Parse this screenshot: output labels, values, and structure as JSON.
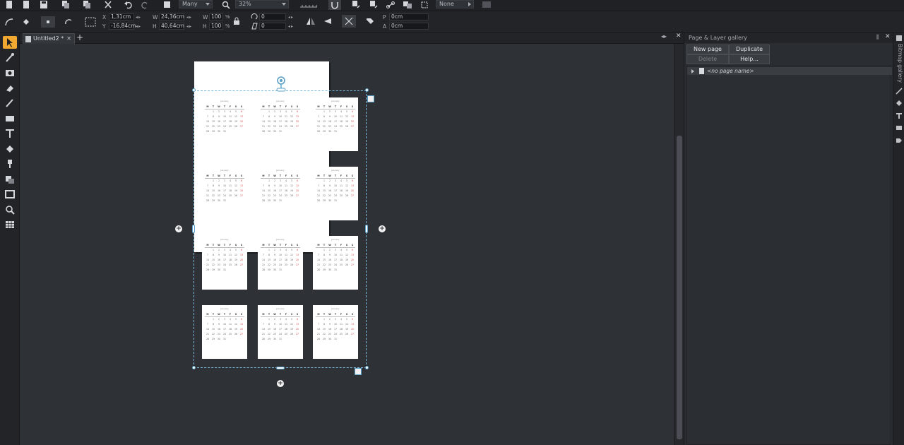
{
  "toolbar": {
    "items_combo": "Many",
    "zoom_combo": "32%",
    "feather_combo": "None",
    "x_label": "X",
    "x_value": "1,31cm",
    "y_label": "Y",
    "y_value": "-16,84cm",
    "w_label": "W",
    "w_value": "24,36cm",
    "h_label": "H",
    "h_value": "40,64cm",
    "sw_label": "W",
    "sw_value": "100",
    "sh_label": "H",
    "sh_value": "100",
    "pct": "%",
    "angle_value": "0",
    "skew_value": "0",
    "p_label": "P",
    "p_value": "0cm",
    "a_label": "A",
    "a_value": "0cm"
  },
  "tabs": {
    "document": "Untitled2 *",
    "close": "✕",
    "new": "+"
  },
  "calendar": {
    "month_title": "January",
    "days": [
      "M",
      "T",
      "W",
      "T",
      "F",
      "S",
      "S"
    ],
    "dates": [
      [
        "",
        "1",
        "2",
        "3",
        "4",
        "5",
        "6"
      ],
      [
        "7",
        "8",
        "9",
        "10",
        "11",
        "12",
        "13"
      ],
      [
        "14",
        "15",
        "16",
        "17",
        "18",
        "19",
        "20"
      ],
      [
        "21",
        "22",
        "23",
        "24",
        "25",
        "26",
        "27"
      ],
      [
        "28",
        "29",
        "30",
        "31",
        "",
        "",
        ""
      ]
    ]
  },
  "gallery": {
    "title": "Page & Layer gallery",
    "new_page": "New page",
    "duplicate": "Duplicate",
    "delete": "Delete",
    "help": "Help...",
    "row_label": "<no page name>",
    "side_label": "Bitmap gallery"
  }
}
